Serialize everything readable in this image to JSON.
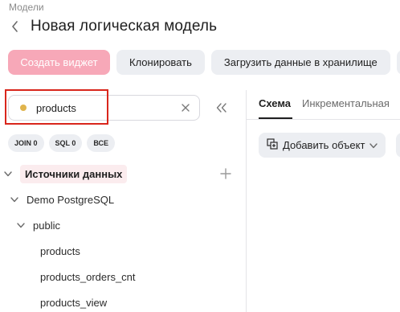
{
  "breadcrumb": "Модели",
  "page_title": "Новая логическая модель",
  "toolbar": {
    "create_widget": "Создать виджет",
    "clone": "Клонировать",
    "load_to_storage": "Загрузить данные в хранилище"
  },
  "colors": {
    "primary_disabled": "#f7a8b8",
    "highlight": "#d9261c",
    "search_dot": "#e0b44c"
  },
  "search": {
    "value": "products"
  },
  "filters": [
    {
      "label": "JOIN 0"
    },
    {
      "label": "SQL 0"
    },
    {
      "label": "ВСЕ"
    }
  ],
  "tree": {
    "root_label": "Источники данных",
    "connection": "Demo PostgreSQL",
    "schema": "public",
    "items": [
      {
        "label": "products"
      },
      {
        "label": "products_orders_cnt"
      },
      {
        "label": "products_view"
      }
    ]
  },
  "tabs": [
    {
      "label": "Схема",
      "active": true
    },
    {
      "label": "Инкрементальная"
    }
  ],
  "add_object": "Добавить объект"
}
